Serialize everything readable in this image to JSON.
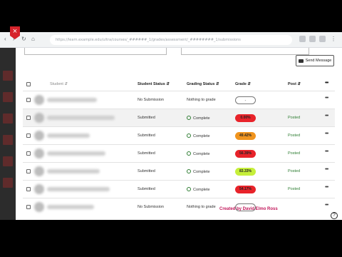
{
  "browser": {
    "url": "https://learn.example.edu/ultra/courses/_######_1/grades/assessment/_########_1/submissions"
  },
  "toolbar": {
    "close_label": "×",
    "send_message_label": "Send Message"
  },
  "table": {
    "headers": {
      "student": "Student ⇵",
      "student_status": "Student Status ⇵",
      "grading_status": "Grading Status ⇵",
      "grade": "Grade ⇵",
      "post": "Post ⇵",
      "more": "•••"
    },
    "rows": [
      {
        "student_status": "No Submission",
        "grading_status": "Nothing to grade",
        "complete": false,
        "grade": "-",
        "grade_color": "#ffffff",
        "post": ""
      },
      {
        "student_status": "Submitted",
        "grading_status": "Complete",
        "complete": true,
        "grade": "0.00%",
        "grade_color": "#e8232a",
        "post": "Posted"
      },
      {
        "student_status": "Submitted",
        "grading_status": "Complete",
        "complete": true,
        "grade": "49.42%",
        "grade_color": "#f0941e",
        "post": "Posted"
      },
      {
        "student_status": "Submitted",
        "grading_status": "Complete",
        "complete": true,
        "grade": "56.39%",
        "grade_color": "#e8232a",
        "post": "Posted"
      },
      {
        "student_status": "Submitted",
        "grading_status": "Complete",
        "complete": true,
        "grade": "83.33%",
        "grade_color": "#c6ef3a",
        "post": "Posted"
      },
      {
        "student_status": "Submitted",
        "grading_status": "Complete",
        "complete": true,
        "grade": "54.17%",
        "grade_color": "#e8232a",
        "post": "Posted"
      },
      {
        "student_status": "No Submission",
        "grading_status": "Nothing to grade",
        "complete": false,
        "grade": "-",
        "grade_color": "#ffffff",
        "post": ""
      }
    ]
  },
  "watermark": "Created by David Elmo Ross",
  "help_label": "?"
}
